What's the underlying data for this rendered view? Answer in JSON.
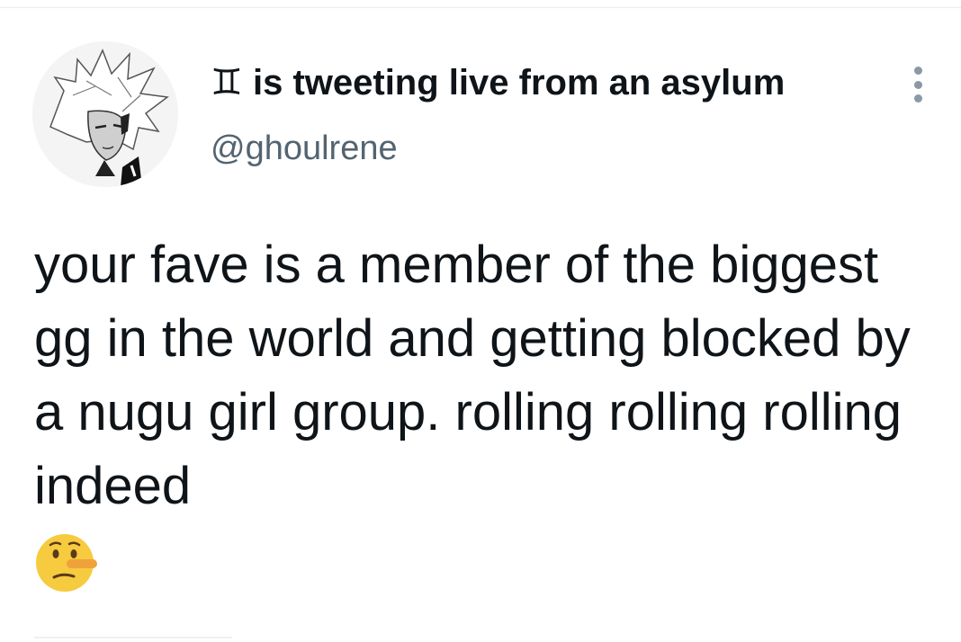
{
  "tweet": {
    "display_name": "♊ is tweeting live from an asylum",
    "handle": "@ghoulrene",
    "text": "your fave is a member of the biggest gg in the world and getting blocked by a nugu girl group. rolling rolling rolling indeed",
    "emoji_icon": "lying-face-icon"
  },
  "colors": {
    "text_primary": "#0f1419",
    "text_secondary": "#536471",
    "emoji_face": "#f7cb3f",
    "emoji_nose": "#f0a23a"
  }
}
